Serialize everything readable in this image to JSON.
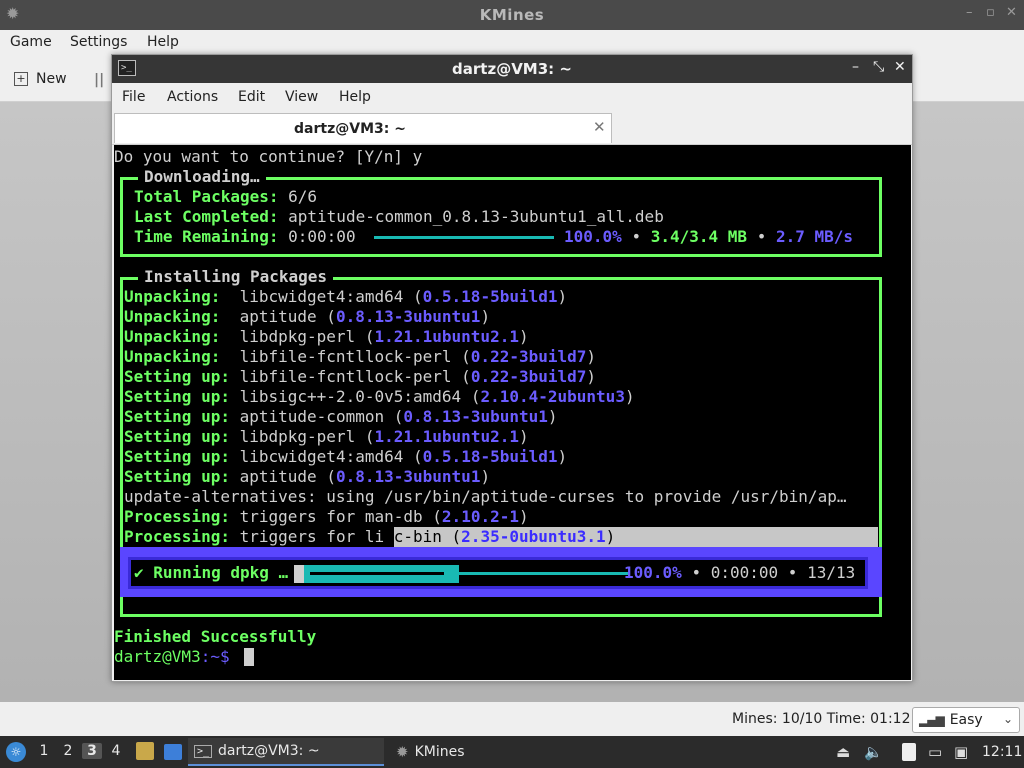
{
  "kmines": {
    "title": "KMines",
    "window_controls": [
      "–",
      "▫",
      "✕"
    ],
    "menu": [
      "Game",
      "Settings",
      "Help"
    ],
    "toolbar": {
      "new_label": "New",
      "pause_symbol": "||"
    },
    "status": {
      "text": "Mines: 10/10  Time: 01:12"
    },
    "difficulty": {
      "selected": "Easy"
    }
  },
  "terminal": {
    "title": "dartz@VM3: ~",
    "window_controls": [
      "–",
      "⤡",
      "✕"
    ],
    "menu": [
      "File",
      "Actions",
      "Edit",
      "View",
      "Help"
    ],
    "tab": {
      "label": "dartz@VM3: ~",
      "close": "✕"
    },
    "prompt_line": "Do you want to continue? [Y/n] y",
    "download": {
      "box_title": "Downloading…",
      "total_label": "Total Packages:",
      "total_value": "6/6",
      "last_label": "Last Completed:",
      "last_value": "aptitude-common_0.8.13-3ubuntu1_all.deb",
      "time_label": "Time Remaining:",
      "time_value": "0:00:00",
      "percent": "100.0%",
      "sep": "•",
      "size": "3.4/3.4 MB",
      "rate": "2.7 MB/s",
      "progress": 1.0
    },
    "install": {
      "box_title": "Installing Packages",
      "lines": [
        {
          "action": "Unpacking:",
          "pkg": "libcwidget4:amd64",
          "ver": "0.5.18-5build1"
        },
        {
          "action": "Unpacking:",
          "pkg": "aptitude",
          "ver": "0.8.13-3ubuntu1"
        },
        {
          "action": "Unpacking:",
          "pkg": "libdpkg-perl",
          "ver": "1.21.1ubuntu2.1"
        },
        {
          "action": "Unpacking:",
          "pkg": "libfile-fcntllock-perl",
          "ver": "0.22-3build7"
        },
        {
          "action": "Setting up:",
          "pkg": "libfile-fcntllock-perl",
          "ver": "0.22-3build7"
        },
        {
          "action": "Setting up:",
          "pkg": "libsigc++-2.0-0v5:amd64",
          "ver": "2.10.4-2ubuntu3"
        },
        {
          "action": "Setting up:",
          "pkg": "aptitude-common",
          "ver": "0.8.13-3ubuntu1"
        },
        {
          "action": "Setting up:",
          "pkg": "libdpkg-perl",
          "ver": "1.21.1ubuntu2.1"
        },
        {
          "action": "Setting up:",
          "pkg": "libcwidget4:amd64",
          "ver": "0.5.18-5build1"
        },
        {
          "action": "Setting up:",
          "pkg": "aptitude",
          "ver": "0.8.13-3ubuntu1"
        }
      ],
      "alt_line": "update-alternatives: using /usr/bin/aptitude-curses to provide /usr/bin/ap…",
      "proc1": {
        "action": "Processing:",
        "text": "triggers for man-db",
        "ver": "2.10.2-1"
      },
      "proc2": {
        "action": "Processing:",
        "text_a": "triggers for li",
        "text_b": "bc-bin",
        "ver": "2.35-0ubuntu3.1"
      }
    },
    "dpkg": {
      "check": "✔",
      "label": "Running dpkg …",
      "percent": "100.0%",
      "sep": "•",
      "time": "0:00:00",
      "count": "13/13",
      "progress": 1.0
    },
    "finished": "Finished Successfully",
    "prompt_user": "dartz@VM3",
    "prompt_path": ":~$"
  },
  "taskbar": {
    "desktops": [
      "1",
      "2",
      "3",
      "4"
    ],
    "active_desktop": "3",
    "tasks": [
      {
        "label": "dartz@VM3: ~",
        "active": true
      },
      {
        "label": "KMines",
        "active": false
      }
    ],
    "clock": "12:11"
  },
  "colors": {
    "terminal_green": "#6dff63",
    "terminal_blue": "#6b5cff",
    "progress_teal": "#19b9b3",
    "dpkg_band": "#5a46ff"
  }
}
